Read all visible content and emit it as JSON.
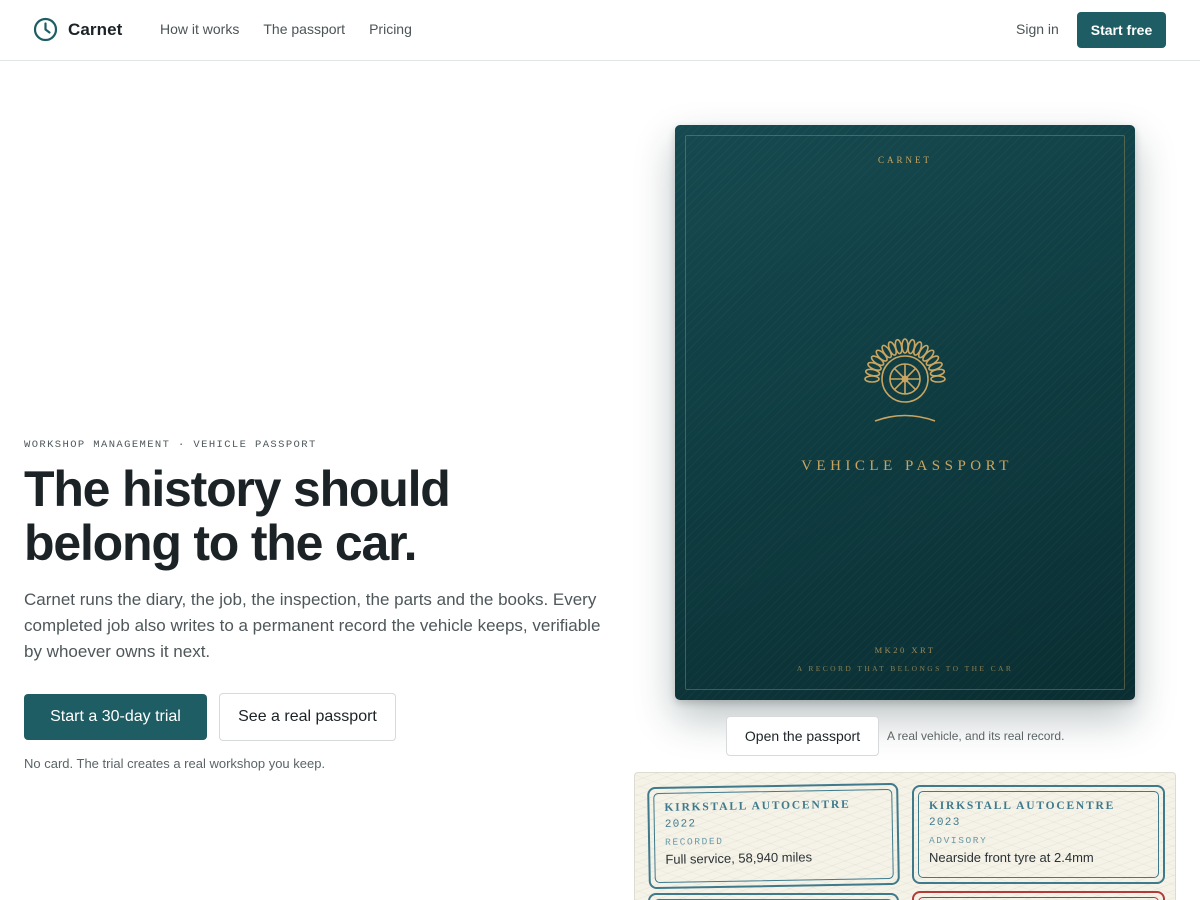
{
  "header": {
    "brand": "Carnet",
    "nav": [
      "How it works",
      "The passport",
      "Pricing"
    ],
    "sign_in": "Sign in",
    "start_free": "Start free"
  },
  "hero": {
    "eyebrow": "WORKSHOP MANAGEMENT · VEHICLE PASSPORT",
    "headline_line1": "The history should",
    "headline_line2": "belong to the car.",
    "lede": "Carnet runs the diary, the job, the inspection, the parts and the books. Every completed job also writes to a permanent record the vehicle keeps, verifiable by whoever owns it next.",
    "primary_cta": "Start a 30-day trial",
    "secondary_cta": "See a real passport",
    "fineprint": "No card. The trial creates a real workshop you keep."
  },
  "passport": {
    "brand": "CARNET",
    "title": "VEHICLE PASSPORT",
    "registration": "MK20 XRT",
    "tagline": "A RECORD THAT BELONGS TO THE CAR",
    "emblem_icon": "wheel-laurel-emblem-icon",
    "open_button": "Open the passport",
    "open_caption": "A real vehicle, and its real record."
  },
  "stamps": [
    {
      "garage": "KIRKSTALL AUTOCENTRE",
      "year": "2022",
      "status": "RECORDED",
      "detail": "Full service, 58,940 miles"
    },
    {
      "garage": "KIRKSTALL AUTOCENTRE",
      "year": "2023",
      "status": "ADVISORY",
      "detail": "Nearside front tyre at 2.4mm"
    }
  ],
  "colors": {
    "accent": "#1e5d63",
    "passport_cover": "#0f3a3f",
    "passport_gold": "#c9a561",
    "stamp_blue": "#3e7a8c",
    "stamp_red": "#b43a3a",
    "paper": "#f5f2e8"
  },
  "icons": {
    "brand": "clock-logo-icon"
  }
}
